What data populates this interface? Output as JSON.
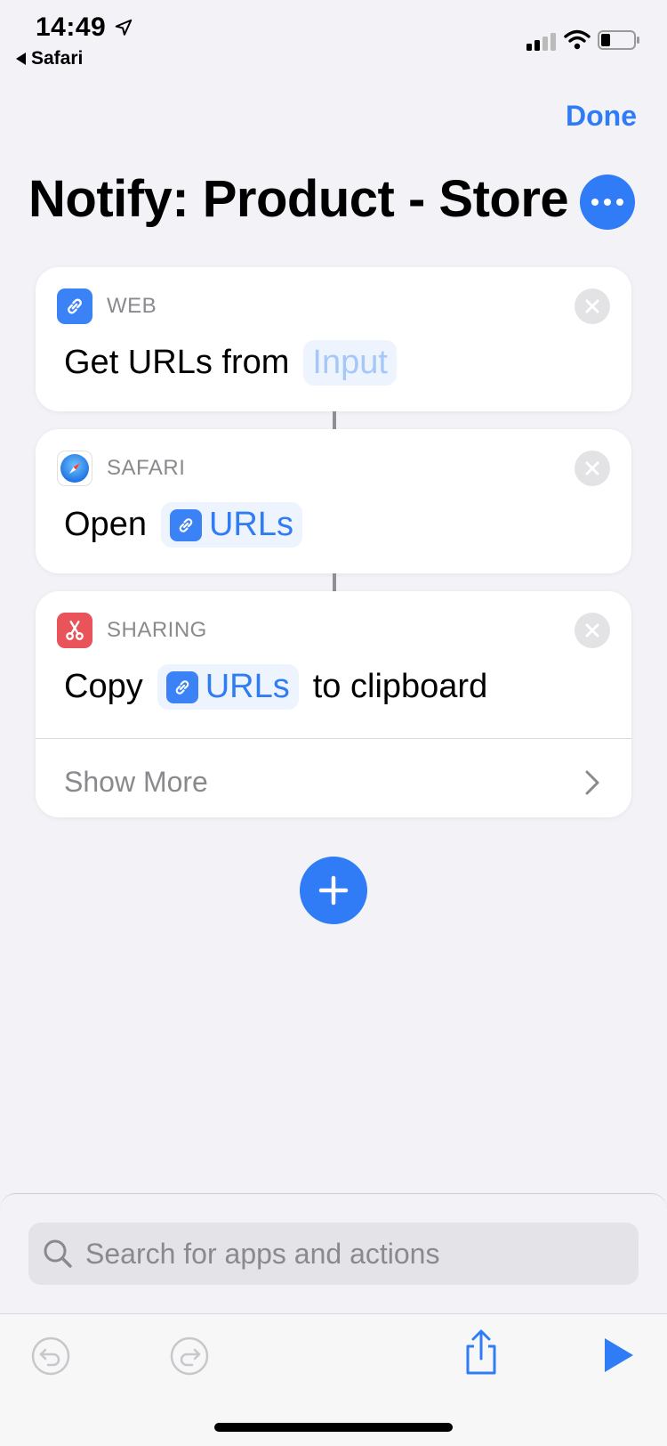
{
  "status_bar": {
    "time": "14:49",
    "back_app": "Safari"
  },
  "header": {
    "done_label": "Done",
    "title": "Notify: Product - Store"
  },
  "actions": [
    {
      "category": "WEB",
      "prefix": "Get URLs from",
      "token": "Input",
      "suffix": ""
    },
    {
      "category": "SAFARI",
      "prefix": "Open",
      "token": "URLs",
      "suffix": ""
    },
    {
      "category": "SHARING",
      "prefix": "Copy",
      "token": "URLs",
      "suffix": "to clipboard",
      "show_more": "Show More"
    }
  ],
  "search": {
    "placeholder": "Search for apps and actions"
  },
  "icons": {
    "web": "link-icon",
    "safari": "compass-icon",
    "sharing": "scissors-icon",
    "add": "plus-icon",
    "undo": "undo-icon",
    "redo": "redo-icon",
    "share": "share-icon",
    "play": "play-icon"
  },
  "colors": {
    "accent": "#2f7cf6",
    "background": "#f2f2f7",
    "sharing_red": "#e8545a"
  }
}
